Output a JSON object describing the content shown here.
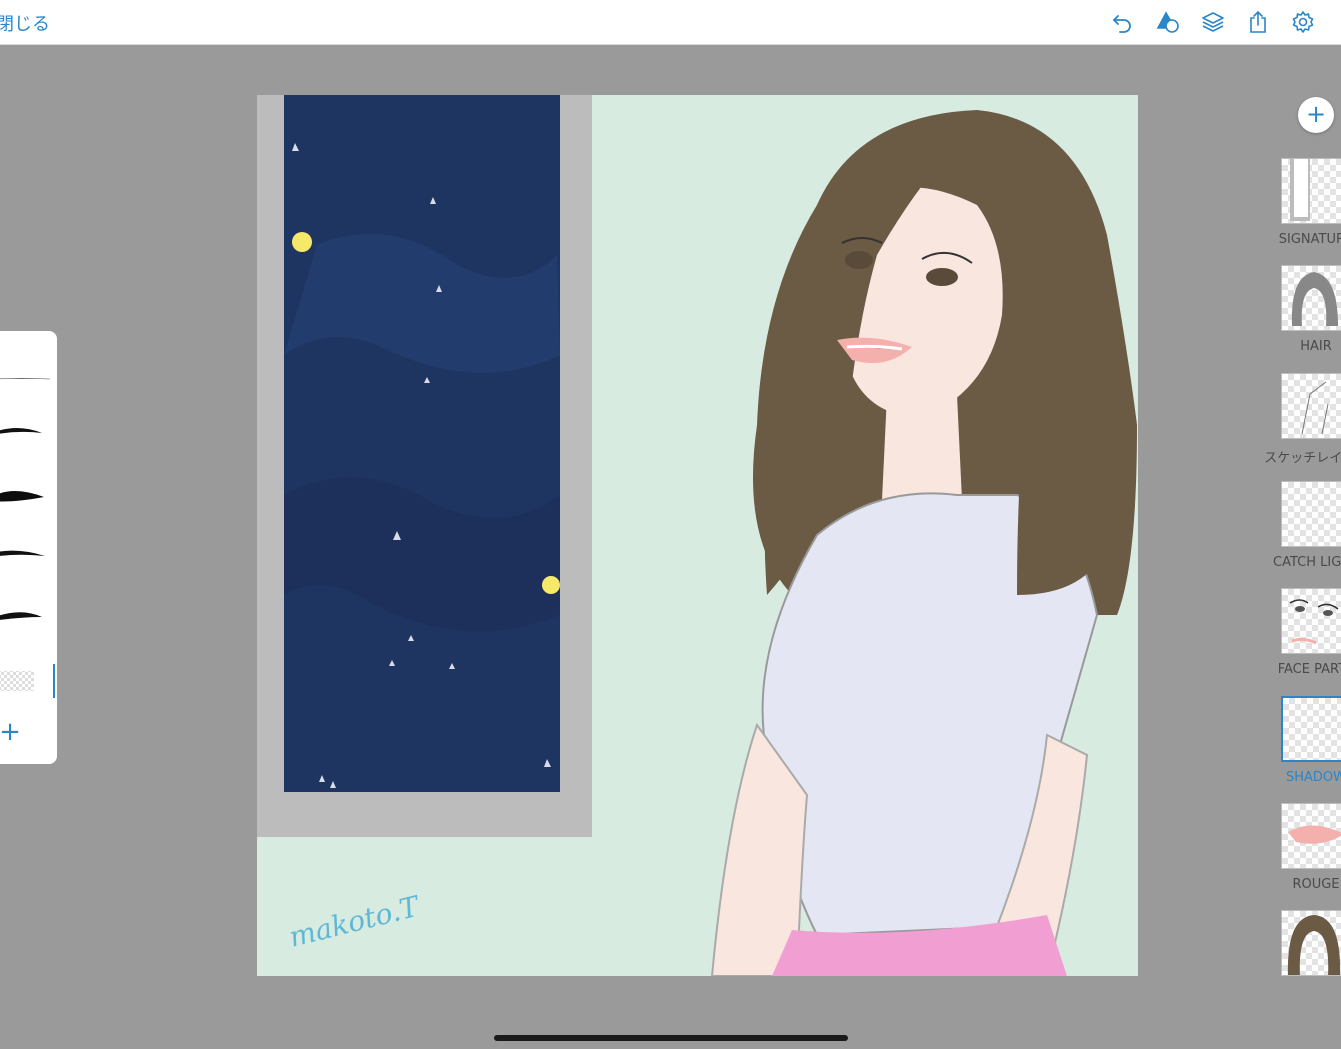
{
  "topbar": {
    "close_label": "閉じる",
    "tools": [
      "undo-icon",
      "shapes-icon",
      "layers-icon",
      "share-icon",
      "settings-icon"
    ]
  },
  "brushes": {
    "add_label": "+",
    "items": [
      "brush-1",
      "brush-2",
      "brush-3",
      "brush-4",
      "brush-5",
      "brush-6"
    ]
  },
  "canvas": {
    "signature_text": "makoto.T"
  },
  "layers": {
    "add_label": "+",
    "items": [
      {
        "label": "SIGNATURE"
      },
      {
        "label": "HAIR"
      },
      {
        "label": "スケッチレイヤー"
      },
      {
        "label": "CATCH LIGHT"
      },
      {
        "label": "FACE PARTS"
      },
      {
        "label": "SHADOW"
      },
      {
        "label": "ROUGE"
      },
      {
        "label": ""
      }
    ],
    "selected_index": 5
  },
  "colors": {
    "accent": "#2a86c8",
    "workspace": "#9a9a9a",
    "canvas_bg": "#d8ebe0",
    "night_sky": "#1f3561",
    "hair": "#6b5a44",
    "shirt": "#e4e6f4",
    "skirt": "#f19fd2",
    "skin": "#f9e6df",
    "lips": "#f4b0ac"
  }
}
